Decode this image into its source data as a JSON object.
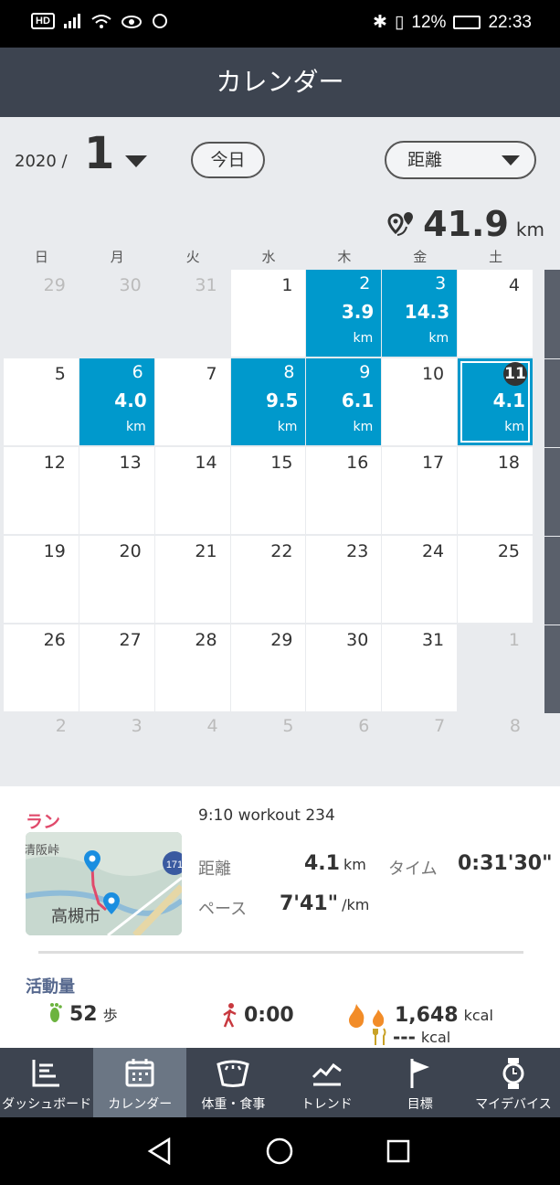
{
  "status": {
    "left_badge": "HD",
    "battery_pct": "12%",
    "time": "22:33"
  },
  "header": {
    "title": "カレンダー"
  },
  "topbar": {
    "year": "2020 /",
    "month": "1",
    "today_label": "今日",
    "metric": "距離",
    "total_value": "41.9",
    "total_unit": "km"
  },
  "weekdays": [
    "日",
    "月",
    "火",
    "水",
    "木",
    "金",
    "土"
  ],
  "calendar": {
    "unit": "km",
    "weeks": [
      [
        {
          "d": "29",
          "other": true
        },
        {
          "d": "30",
          "other": true
        },
        {
          "d": "31",
          "other": true
        },
        {
          "d": "1"
        },
        {
          "d": "2",
          "v": "3.9"
        },
        {
          "d": "3",
          "v": "14.3"
        },
        {
          "d": "4"
        }
      ],
      [
        {
          "d": "5"
        },
        {
          "d": "6",
          "v": "4.0"
        },
        {
          "d": "7"
        },
        {
          "d": "8",
          "v": "9.5"
        },
        {
          "d": "9",
          "v": "6.1"
        },
        {
          "d": "10"
        },
        {
          "d": "11",
          "v": "4.1",
          "today": true
        }
      ],
      [
        {
          "d": "12"
        },
        {
          "d": "13"
        },
        {
          "d": "14"
        },
        {
          "d": "15"
        },
        {
          "d": "16"
        },
        {
          "d": "17"
        },
        {
          "d": "18"
        }
      ],
      [
        {
          "d": "19"
        },
        {
          "d": "20"
        },
        {
          "d": "21"
        },
        {
          "d": "22"
        },
        {
          "d": "23"
        },
        {
          "d": "24"
        },
        {
          "d": "25"
        }
      ],
      [
        {
          "d": "26"
        },
        {
          "d": "27"
        },
        {
          "d": "28"
        },
        {
          "d": "29"
        },
        {
          "d": "30"
        },
        {
          "d": "31"
        },
        {
          "d": "1",
          "other": true
        }
      ]
    ],
    "next_row": [
      "2",
      "3",
      "4",
      "5",
      "6",
      "7",
      "8"
    ]
  },
  "detail": {
    "activity": "ラン",
    "workout_title": "9:10  workout 234",
    "distance_label": "距離",
    "distance_value": "4.1",
    "distance_unit": "km",
    "time_label": "タイム",
    "time_value": "0:31'30\"",
    "pace_label": "ペース",
    "pace_value": "7'41\"",
    "pace_unit": "/km",
    "map_label1": "高槻市",
    "map_label2": "清阪峠",
    "map_road": "171"
  },
  "activity_amount": {
    "title": "活動量",
    "steps": "52",
    "steps_unit": "歩",
    "active_time": "0:00",
    "kcal": "1,648",
    "kcal_unit": "kcal",
    "food_kcal": "---",
    "food_kcal_unit": "kcal"
  },
  "nav": [
    "ダッシュボード",
    "カレンダー",
    "体重・食事",
    "トレンド",
    "目標",
    "マイデバイス"
  ],
  "colors": {
    "accent": "#0099cc",
    "header": "#3d4450",
    "run": "#e04a6b"
  }
}
